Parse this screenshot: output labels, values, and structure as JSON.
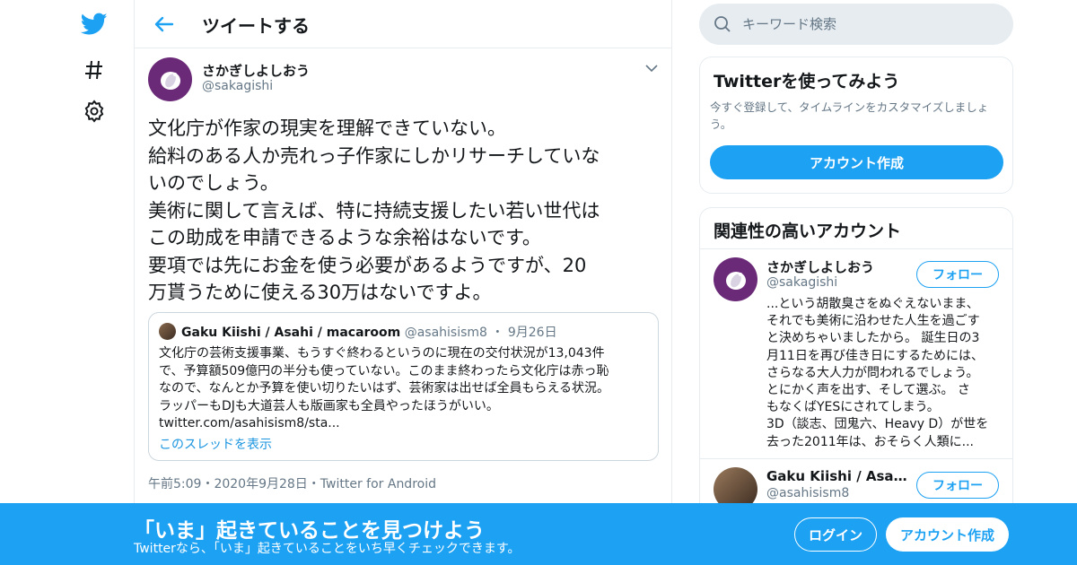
{
  "nav": {
    "icons": [
      "twitter-bird-icon",
      "hashtag-icon",
      "gear-icon"
    ]
  },
  "header": {
    "title": "ツイートする"
  },
  "tweet": {
    "author_name": "さかぎしよしおう",
    "author_handle": "@sakagishi",
    "text_lines": [
      "文化庁が作家の現実を理解できていない。",
      "給料のある人か売れっ子作家にしかリサーチしていな",
      "いのでしょう。",
      "美術に関して言えば、特に持続支援したい若い世代は",
      "この助成を申請できるような余裕はないです。",
      "要項では先にお金を使う必要があるようですが、20",
      "万貰うために使える30万はないですよ。"
    ],
    "timestamp": "午前5:09・2020年9月28日・Twitter for Android"
  },
  "quote": {
    "name": "Gaku Kiishi / Asahi / macaroom",
    "handle": "@asahisism8",
    "date": "9月26日",
    "body_lines": [
      "文化庁の芸術支援事業、もうすぐ終わるというのに現在の交付状況が13,043件",
      "で、予算額509億円の半分も使っていない。このまま終わったら文化庁は赤っ恥",
      "なので、なんとか予算を使い切りたいはず、芸術家は出せば全員もらえる状況。",
      "ラッパーもDJも大道芸人も版画家も全員やったほうがいい。",
      "twitter.com/asahisism8/sta..."
    ],
    "thread_link": "このスレッドを表示"
  },
  "search": {
    "placeholder": "キーワード検索"
  },
  "signup_card": {
    "title": "Twitterを使ってみよう",
    "desc": "今すぐ登録して、タイムラインをカスタマイズしましょう。",
    "button": "アカウント作成"
  },
  "related": {
    "title": "関連性の高いアカウント",
    "accounts": [
      {
        "name": "さかぎしよしおう",
        "handle": "@sakagishi",
        "follow": "フォロー",
        "bio_lines": [
          "...という胡散臭さをぬぐえないまま、",
          "それでも美術に沿わせた人生を過ごす",
          "と決めちゃいましたから。 誕生日の3",
          "月11日を再び佳き日にするためには、",
          "さらなる大人力が問われるでしょう。",
          "とにかく声を出す、そして選ぶ。 さ",
          "もなくばYESにされてしまう。",
          "3D（談志、団鬼六、Heavy D）が世を",
          "去った2011年は、おそらく人類に..."
        ]
      },
      {
        "name": "Gaku Kiishi / Asahi / ...",
        "handle": "@asahisism8",
        "follow": "フォロー"
      }
    ]
  },
  "banner": {
    "title": "「いま」起きていることを見つけよう",
    "subtitle": "Twitterなら、「いま」起きていることをいち早くチェックできます。",
    "login": "ログイン",
    "signup": "アカウント作成"
  },
  "colors": {
    "accent": "#1da1f2",
    "text": "#14171a",
    "muted": "#657786",
    "border": "#e6ecf0",
    "avatar_purple": "#6b2a78"
  }
}
